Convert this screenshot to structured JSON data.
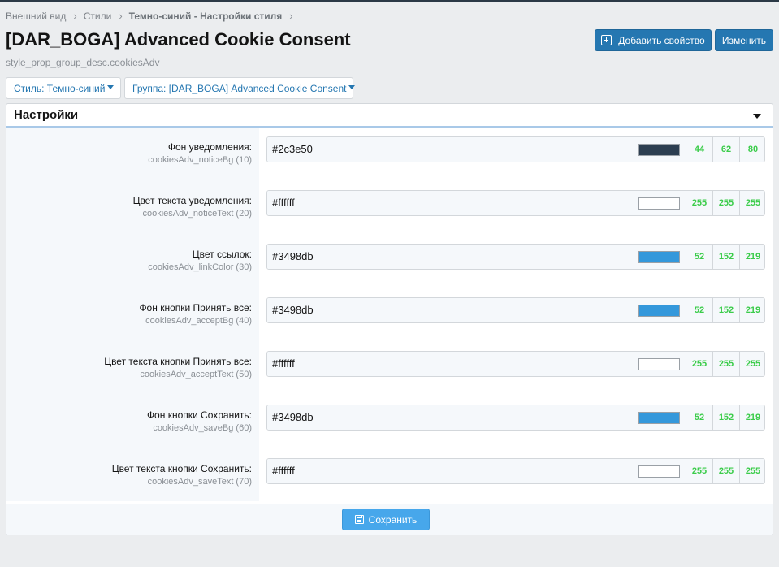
{
  "breadcrumb": [
    {
      "label": "Внешний вид"
    },
    {
      "label": "Стили"
    },
    {
      "label": "Темно-синий - Настройки стиля"
    }
  ],
  "page": {
    "title": "[DAR_BOGA] Advanced Cookie Consent",
    "description": "style_prop_group_desc.cookiesAdv"
  },
  "actions": {
    "add_label": "Добавить свойство",
    "edit_label": "Изменить"
  },
  "filters": {
    "style_label": "Стиль: Темно-синий",
    "group_label": "Группа: [DAR_BOGA] Advanced Cookie Consent"
  },
  "block": {
    "title": "Настройки",
    "save_label": "Сохранить"
  },
  "properties": [
    {
      "title": "Фон уведомления:",
      "hint": "cookiesAdv_noticeBg (10)",
      "value": "#2c3e50",
      "swatch": "#2c3e50",
      "r": "44",
      "g": "62",
      "b": "80"
    },
    {
      "title": "Цвет текста уведомления:",
      "hint": "cookiesAdv_noticeText (20)",
      "value": "#ffffff",
      "swatch": "#ffffff",
      "r": "255",
      "g": "255",
      "b": "255"
    },
    {
      "title": "Цвет ссылок:",
      "hint": "cookiesAdv_linkColor (30)",
      "value": "#3498db",
      "swatch": "#3498db",
      "r": "52",
      "g": "152",
      "b": "219"
    },
    {
      "title": "Фон кнопки Принять все:",
      "hint": "cookiesAdv_acceptBg (40)",
      "value": "#3498db",
      "swatch": "#3498db",
      "r": "52",
      "g": "152",
      "b": "219"
    },
    {
      "title": "Цвет текста кнопки Принять все:",
      "hint": "cookiesAdv_acceptText (50)",
      "value": "#ffffff",
      "swatch": "#ffffff",
      "r": "255",
      "g": "255",
      "b": "255"
    },
    {
      "title": "Фон кнопки Сохранить:",
      "hint": "cookiesAdv_saveBg (60)",
      "value": "#3498db",
      "swatch": "#3498db",
      "r": "52",
      "g": "152",
      "b": "219"
    },
    {
      "title": "Цвет текста кнопки Сохранить:",
      "hint": "cookiesAdv_saveText (70)",
      "value": "#ffffff",
      "swatch": "#ffffff",
      "r": "255",
      "g": "255",
      "b": "255"
    }
  ],
  "colors": {
    "primary_button": "#2577b1",
    "save_button": "#47a7eb",
    "rgb_text": "#3bcc4a",
    "header_underline": "#a9c9e8"
  }
}
